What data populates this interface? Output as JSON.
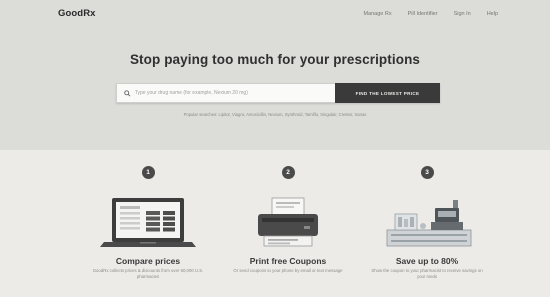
{
  "header": {
    "logo": "GoodRx",
    "nav": [
      "Manage Rx",
      "Pill Identifier",
      "Sign In",
      "Help"
    ]
  },
  "hero": {
    "headline": "Stop paying too much for your prescriptions",
    "search_placeholder": "Type your drug name (for example, Nexium 20 mg)",
    "search_button": "FIND THE LOWEST PRICE",
    "popular_text": "Popular searches: Lipitor, Viagra, Amoxicillin, Nexium, Synthroid, Tamiflu, Singulair, Crestor, Xanax"
  },
  "steps": [
    {
      "number": "1",
      "icon": "laptop-price-list-icon",
      "title": "Compare prices",
      "desc": "GoodRx collects prices & discounts from over 60,000 U.S. pharmacies"
    },
    {
      "number": "2",
      "icon": "printer-icon",
      "title": "Print free Coupons",
      "desc": "Or send coupons to your phone by email or text message"
    },
    {
      "number": "3",
      "icon": "pharmacy-register-icon",
      "title": "Save up to 80%",
      "desc": "Show the coupon to your pharmacist to receive savings on your meds"
    }
  ],
  "colors": {
    "hero_bg": "#dcdcd9",
    "page_bg": "#ecebe8",
    "button_bg": "#3a3a3a",
    "step_badge": "#4a4a4a"
  }
}
